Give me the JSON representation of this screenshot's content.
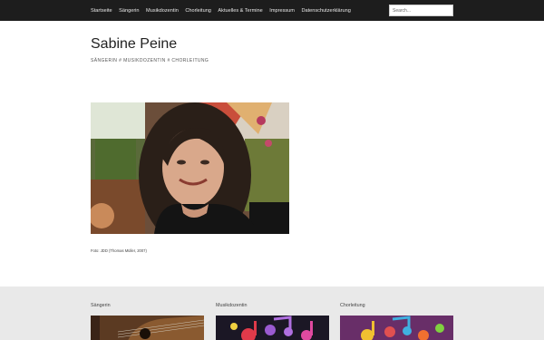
{
  "nav": {
    "items": [
      {
        "label": "Startseite"
      },
      {
        "label": "Sängerin"
      },
      {
        "label": "Musikdozentin"
      },
      {
        "label": "Chorleitung"
      },
      {
        "label": "Aktuelles & Termine"
      },
      {
        "label": "Impressum"
      },
      {
        "label": "Datenschutzerklärung"
      }
    ],
    "search_placeholder": "Search..."
  },
  "header": {
    "site_title": "Sabine Peine",
    "tagline": "SÄNGERIN # MUSIKDOZENTIN # CHORLEITUNG"
  },
  "main": {
    "photo_caption": "Foto: JDD (Thomas Müller, 2007)"
  },
  "footer": {
    "widgets": [
      {
        "title": "Sängerin"
      },
      {
        "title": "Musikdozentin"
      },
      {
        "title": "Chorleitung"
      }
    ]
  },
  "colors": {
    "topbar": "#1d1d1d",
    "footer_bg": "#e9e9e9"
  }
}
